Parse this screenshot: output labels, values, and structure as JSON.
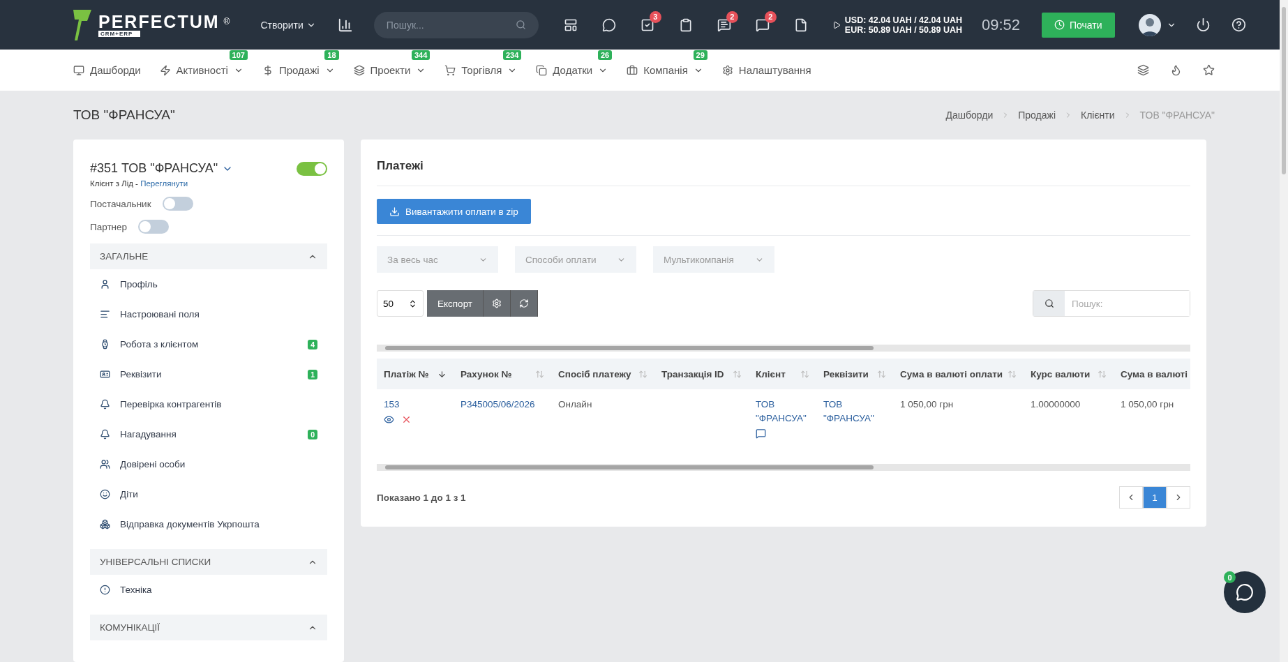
{
  "topbar": {
    "logo": "PERFECTUM",
    "logo_mark": "®",
    "logo_sub": "CRM+ERP",
    "create": "Створити",
    "search_placeholder": "Пошук...",
    "icons": [
      {
        "kind": "layout"
      },
      {
        "kind": "chat"
      },
      {
        "kind": "tasks",
        "badge": "3"
      },
      {
        "kind": "clipboard"
      },
      {
        "kind": "comments",
        "badge": "2"
      },
      {
        "kind": "messages",
        "badge": "2"
      },
      {
        "kind": "file"
      }
    ],
    "rates": [
      "USD: 42.04 UAH / 42.04 UAH",
      "EUR: 50.89 UAH / 50.89 UAH"
    ],
    "time": "09:52",
    "start": "Почати"
  },
  "nav": {
    "items": [
      {
        "kind": "monitor",
        "label": "Дашборди",
        "dropdown": false
      },
      {
        "kind": "zap",
        "label": "Активності",
        "badge": "107",
        "dropdown": true
      },
      {
        "kind": "dollar",
        "label": "Продажі",
        "badge": "18",
        "dropdown": true
      },
      {
        "kind": "layers",
        "label": "Проекти",
        "badge": "344",
        "dropdown": true
      },
      {
        "kind": "cart",
        "label": "Торгівля",
        "badge": "234",
        "dropdown": true
      },
      {
        "kind": "copy",
        "label": "Додатки",
        "badge": "26",
        "dropdown": true
      },
      {
        "kind": "briefcase",
        "label": "Компанія",
        "badge": "29",
        "dropdown": true
      },
      {
        "kind": "gear",
        "label": "Налаштування",
        "dropdown": false
      }
    ]
  },
  "page": {
    "title": "ТОВ \"ФРАНСУА\"",
    "breadcrumbs": [
      "Дашборди",
      "Продажі",
      "Клієнти",
      "ТОВ \"ФРАНСУА\""
    ]
  },
  "client": {
    "title": "#351 ТОВ \"ФРАНСУА\"",
    "active": true,
    "subtitle": "Клієнт з Лід - ",
    "subtitle_link": "Переглянути",
    "toggles": [
      {
        "label": "Постачальник",
        "on": false
      },
      {
        "label": "Партнер",
        "on": false
      }
    ],
    "sections": [
      {
        "title": "ЗАГАЛЬНЕ",
        "expanded": true,
        "items": [
          {
            "kind": "user",
            "label": "Профіль"
          },
          {
            "kind": "lines",
            "label": "Настроювані поля"
          },
          {
            "kind": "watch",
            "label": "Робота з клієнтом",
            "badge": "4"
          },
          {
            "kind": "card",
            "label": "Реквізити",
            "badge": "1"
          },
          {
            "kind": "bell",
            "label": "Перевірка контрагентів"
          },
          {
            "kind": "bell",
            "label": "Нагадування",
            "badge": "0"
          },
          {
            "kind": "people",
            "label": "Довірені особи"
          },
          {
            "kind": "smile",
            "label": "Діти"
          },
          {
            "kind": "boxes",
            "label": "Відправка документів Укрпошта"
          }
        ]
      },
      {
        "title": "УНІВЕРСАЛЬНІ СПИСКИ",
        "expanded": true,
        "items": [
          {
            "kind": "alert",
            "label": "Техніка"
          }
        ]
      },
      {
        "title": "КОМУНІКАЦІЇ",
        "expanded": true
      }
    ]
  },
  "payments": {
    "title": "Платежі",
    "download": "Вивантажити оплати в zip",
    "filters": [
      "За весь час",
      "Способи оплати",
      "Мультикомпанія"
    ],
    "page_size": "50",
    "export": "Експорт",
    "search_placeholder": "Пошук:",
    "columns": [
      {
        "label": "Платіж №",
        "sorted": true
      },
      {
        "label": "Рахунок №",
        "sorted": false
      },
      {
        "label": "Спосіб платежу",
        "sorted": false
      },
      {
        "label": "Транзакція ID",
        "sorted": false
      },
      {
        "label": "Клієнт",
        "sorted": false
      },
      {
        "label": "Реквізити",
        "sorted": false
      },
      {
        "label": "Сума в валюті оплати",
        "sorted": false
      },
      {
        "label": "Курс валюти",
        "sorted": false
      },
      {
        "label": "Сума в валюті"
      }
    ],
    "rows": [
      {
        "number": "153",
        "invoice": "Р345005/06/2026",
        "method": "Онлайн",
        "client": "ТОВ \"ФРАНСУА\"",
        "details": "ТОВ \"ФРАНСУА\"",
        "amount": "1 050,00 грн",
        "rate": "1.00000000",
        "amount2": "1 050,00 грн"
      }
    ],
    "summary": "Показано 1 до 1 з 1",
    "pages": [
      {
        "label": "1",
        "selected": true
      }
    ]
  },
  "chat": {
    "badge": "0"
  }
}
